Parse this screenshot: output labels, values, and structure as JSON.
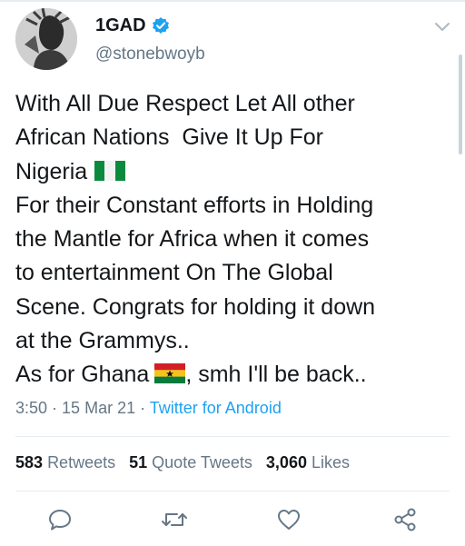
{
  "user": {
    "display_name": "1GAD",
    "handle": "@stonebwoyb",
    "verified": true,
    "avatar_icon": "avatar-photo"
  },
  "tweet": {
    "lines": [
      "With All Due Respect Let All other",
      "African Nations  Give It Up For",
      "Nigeria",
      "For their Constant efforts in Holding",
      "the Mantle for Africa when it comes",
      "to entertainment On The Global",
      "Scene. Congrats for holding it down",
      "at the Grammys..",
      "As for Ghana",
      ", smh I'll be back.."
    ],
    "flags": [
      "nigeria-flag",
      "ghana-flag"
    ]
  },
  "meta": {
    "time": "3:50",
    "separator": " · ",
    "date": "15 Mar 21",
    "source": "Twitter for Android"
  },
  "stats": {
    "retweets_count": "583",
    "retweets_label": "Retweets",
    "quotes_count": "51",
    "quotes_label": "Quote Tweets",
    "likes_count": "3,060",
    "likes_label": "Likes"
  },
  "actions": [
    "reply-icon",
    "retweet-icon",
    "like-icon",
    "share-icon"
  ],
  "colors": {
    "text": "#14171a",
    "secondary": "#657786",
    "accent": "#1da1f2",
    "divider": "#e6ecf0"
  }
}
